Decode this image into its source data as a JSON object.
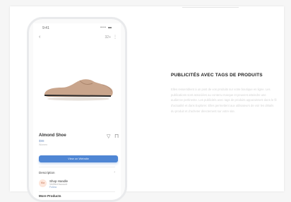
{
  "phone": {
    "status_time": "9:41",
    "status_icons": "▪▪▪ ▬",
    "back_glyph": "‹",
    "price_chip": "32+",
    "more_glyph": "⋮",
    "product": {
      "name": "Almond Shoe",
      "price": "$98",
      "subtitle": "Women"
    },
    "cta_label": "View on Website",
    "description_label": "Description",
    "chevron_glyph": "›",
    "seller": {
      "avatar_text": "Kia",
      "name": "Shop Handle",
      "subtitle": "Verified Account",
      "link": "Follow"
    },
    "more_products_label": "More Products",
    "colors": {
      "accent": "#4f86d4",
      "shoe": "#c9a58c"
    }
  },
  "right": {
    "headline": "PUBLICITÉS AVEC TAGS DE PRODUITS",
    "body": "Elles ressemblent à un post de vos produits sur votre boutique en ligne. Les publications sont associées au contenu marque et peuvent atteindre une audience pertinente. Les publicités avec tags de produits apparaissent dans le fil d'actualité et dans Explorer. Elles permettent aux utilisateurs de voir les détails du produit et d'acheter directement sur votre site."
  }
}
